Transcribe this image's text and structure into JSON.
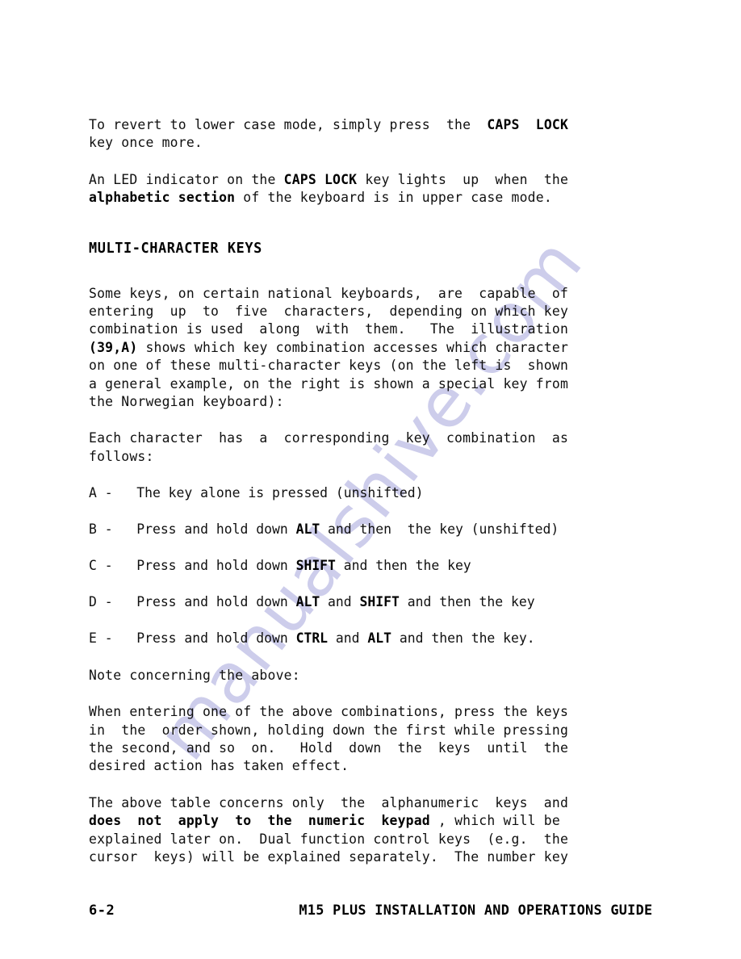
{
  "document": {
    "body_paragraphs": {
      "p1_line1_a": "To revert to lower case mode, simply press  the  ",
      "p1_line1_b": "CAPS  LOCK",
      "p1_line2": "key once more.",
      "p2_a": "An LED indicator on the ",
      "p2_b": "CAPS LOCK",
      "p2_c": " key lights  up  when  the\n",
      "p2_d": "alphabetic section",
      "p2_e": " of the keyboard is in upper case mode.",
      "heading": "MULTI-CHARACTER KEYS",
      "p3_a": "Some keys, on certain national keyboards,  are  capable  of\nentering  up  to  five  characters,  depending on which key\ncombination is used  along  with  them.   The  illustration\n",
      "p3_b": "(39,A)",
      "p3_c": " shows which key combination accesses which character\non one of these multi-character keys (on the left is  shown\na general example, on the right is shown a special key from\nthe Norwegian keyboard):",
      "p4": "Each character  has  a  corresponding  key  combination  as\nfollows:",
      "p5": "Note concerning the above:",
      "p6": "When entering one of the above combinations, press the keys\nin  the  order shown, holding down the first while pressing\nthe second, and so  on.   Hold  down  the  keys  until  the\ndesired action has taken effect.",
      "p7_a": "The above table concerns only  the  alphanumeric  keys  and\n",
      "p7_b": "does  not  apply  to  the  numeric  keypad",
      "p7_c": " , which will be\nexplained later on.  Dual function control keys  (e.g.  the\ncursor  keys) will be explained separately.  The number key"
    },
    "key_combination_list": [
      {
        "letter": "A -",
        "text_before": "   The key alone is pressed (unshifted)",
        "key1": "",
        "text_middle": "",
        "key2": "",
        "text_after": ""
      },
      {
        "letter": "B -",
        "text_before": "   Press and hold down ",
        "key1": "ALT",
        "text_middle": " and then  the key (unshifted)",
        "key2": "",
        "text_after": ""
      },
      {
        "letter": "C -",
        "text_before": "   Press and hold down ",
        "key1": "SHIFT",
        "text_middle": " and then the key",
        "key2": "",
        "text_after": ""
      },
      {
        "letter": "D -",
        "text_before": "   Press and hold down ",
        "key1": "ALT",
        "text_middle": " and ",
        "key2": "SHIFT",
        "text_after": " and then the key"
      },
      {
        "letter": "E -",
        "text_before": "   Press and hold down ",
        "key1": "CTRL",
        "text_middle": " and ",
        "key2": "ALT",
        "text_after": " and then the key."
      }
    ],
    "footer": {
      "page_number": "6-2",
      "title": "M15 PLUS INSTALLATION AND OPERATIONS GUIDE"
    },
    "watermark": {
      "text": "manualshive.com",
      "color": "#c9c9ea"
    }
  }
}
